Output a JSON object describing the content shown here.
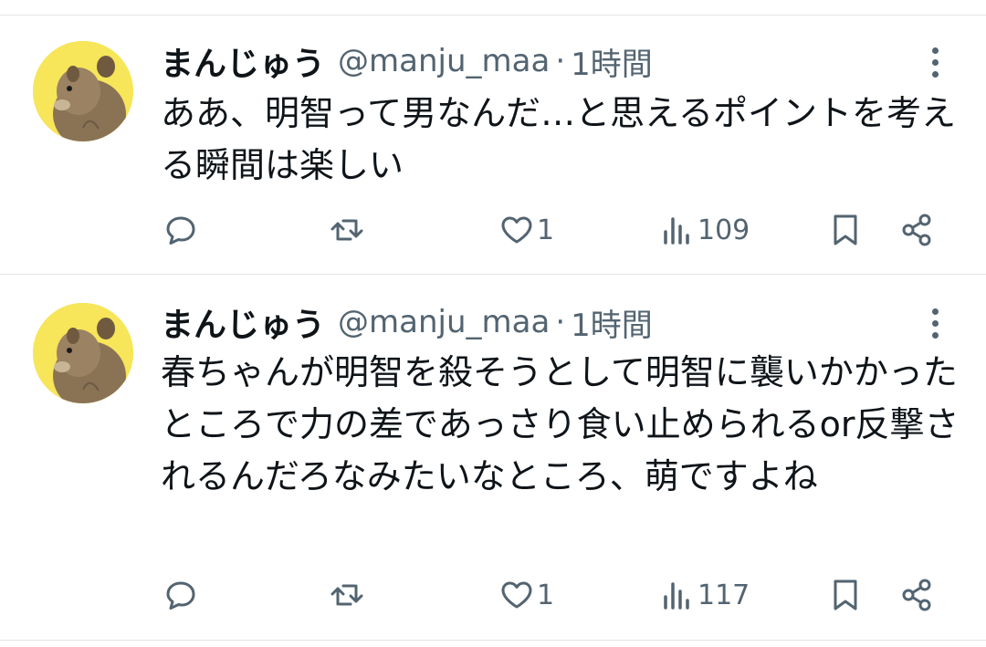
{
  "tweets": [
    {
      "display_name": "まんじゅう",
      "handle": "@manju_maa",
      "separator": "·",
      "time": "1時間",
      "text": "ああ、明智って男なんだ…と思えるポイントを考える瞬間は楽しい",
      "like_count": "1",
      "view_count": "109"
    },
    {
      "display_name": "まんじゅう",
      "handle": "@manju_maa",
      "separator": "·",
      "time": "1時間",
      "text": "春ちゃんが明智を殺そうとして明智に襲いかかったところで力の差であっさり食い止められるor反撃されるんだろなみたいなところ、萌ですよね",
      "like_count": "1",
      "view_count": "117"
    }
  ],
  "icons": {
    "reply": "reply-icon",
    "retweet": "retweet-icon",
    "like": "heart-icon",
    "views": "analytics-icon",
    "bookmark": "bookmark-icon",
    "share": "share-icon",
    "more": "more-vertical-icon"
  },
  "colors": {
    "text": "#0f1419",
    "secondary": "#536471",
    "avatar_bg": "#f7e55a",
    "divider": "#e1e5e8"
  }
}
